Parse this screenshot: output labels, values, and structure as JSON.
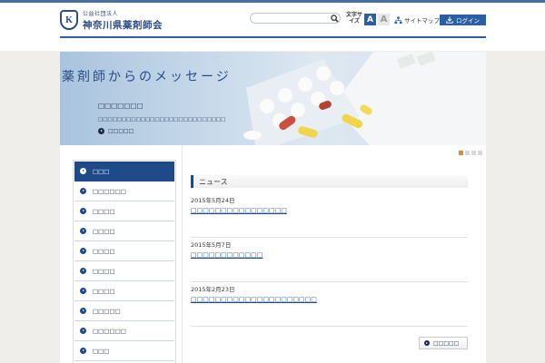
{
  "header": {
    "logo_sub": "公益社団法人",
    "logo_main": "神奈川県薬剤師会",
    "logo_mark": "K",
    "search": {
      "placeholder": "",
      "icon": "search-icon"
    },
    "fontsize_label": "文字サイズ",
    "fontsize_small": "A",
    "fontsize_large": "A",
    "sitemap_label": "サイトマップ",
    "login_label": "ログイン",
    "accent_color": "#2b5fa3"
  },
  "hero": {
    "title": "薬剤師からのメッセージ",
    "subtitle": "□□□□□□□",
    "description": "□□□□□□□□□□□□□□□□□□□□□□□□□□□",
    "more_label": "□□□□□",
    "slides_total": 4,
    "slide_active": 1
  },
  "sidebar": {
    "items": [
      {
        "label": "□□□",
        "active": true
      },
      {
        "label": "□□□□□□"
      },
      {
        "label": "□□□□"
      },
      {
        "label": "□□□□"
      },
      {
        "label": "□□□□"
      },
      {
        "label": "□□□□"
      },
      {
        "label": "□□□□"
      },
      {
        "label": "□□□□□"
      },
      {
        "label": "□□□□□□"
      },
      {
        "label": "□□□"
      }
    ]
  },
  "news": {
    "heading": "ニュース",
    "items": [
      {
        "date": "2015年5月24日",
        "title": "□□□□□□□□□□□□□□□□"
      },
      {
        "date": "2015年5月7日",
        "title": "□□□□□□□□□□□□"
      },
      {
        "date": "2015年2月23日",
        "title": "□□□□□□□□□□□□□□□□□□□□□"
      }
    ],
    "more_label": "□□□□□"
  }
}
